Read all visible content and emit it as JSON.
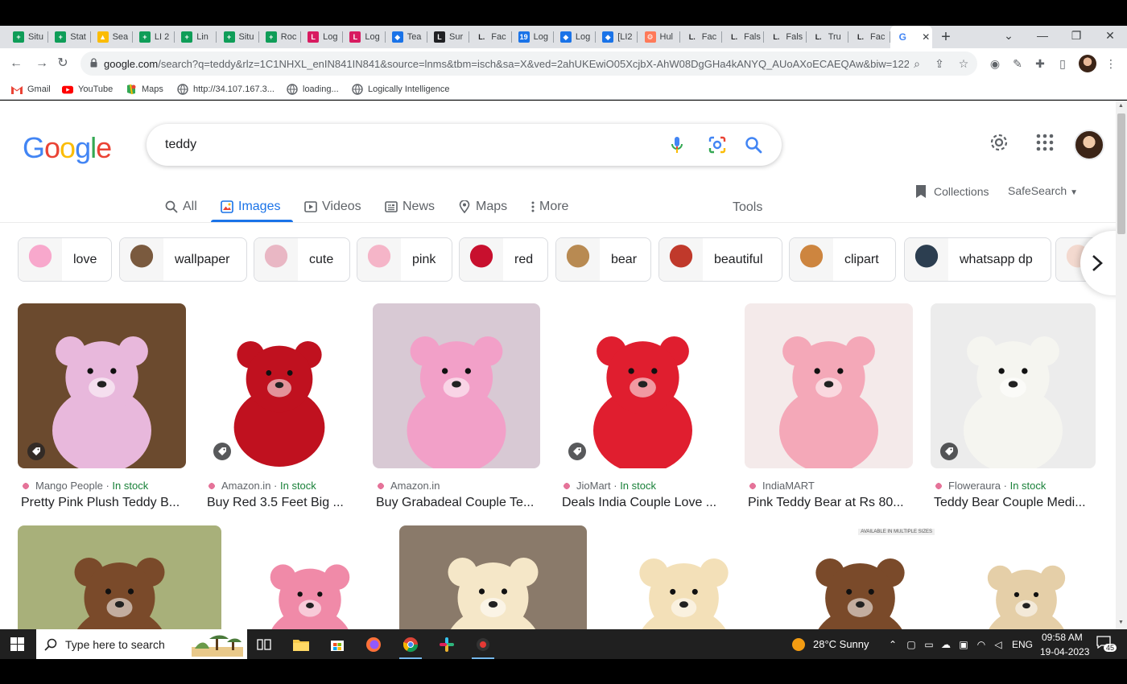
{
  "browser": {
    "tabs": [
      {
        "label": "Situ",
        "fav": "+",
        "color": "#0f9d58"
      },
      {
        "label": "Stat",
        "fav": "+",
        "color": "#0f9d58"
      },
      {
        "label": "Sea",
        "fav": "▲",
        "color": "#fbbc04"
      },
      {
        "label": "LI 2",
        "fav": "+",
        "color": "#0f9d58"
      },
      {
        "label": "Lin",
        "fav": "+",
        "color": "#0f9d58"
      },
      {
        "label": "Situ",
        "fav": "+",
        "color": "#0f9d58"
      },
      {
        "label": "Roc",
        "fav": "+",
        "color": "#0f9d58"
      },
      {
        "label": "Log",
        "fav": "L",
        "color": "#d81b60"
      },
      {
        "label": "Log",
        "fav": "L",
        "color": "#d81b60"
      },
      {
        "label": "Tea",
        "fav": "◆",
        "color": "#1a73e8"
      },
      {
        "label": "Sur",
        "fav": "L",
        "color": "#202124"
      },
      {
        "label": "Fac",
        "fav": "L.",
        "color": "#ffffff"
      },
      {
        "label": "Log",
        "fav": "19",
        "color": "#1a73e8"
      },
      {
        "label": "Log",
        "fav": "◆",
        "color": "#1a73e8"
      },
      {
        "label": "[LI2",
        "fav": "◆",
        "color": "#1a73e8"
      },
      {
        "label": "Hul",
        "fav": "⚙",
        "color": "#ff7a59"
      },
      {
        "label": "Fac",
        "fav": "L.",
        "color": "#ffffff"
      },
      {
        "label": "Fals",
        "fav": "L.",
        "color": "#ffffff"
      },
      {
        "label": "Fals",
        "fav": "L.",
        "color": "#ffffff"
      },
      {
        "label": "Tru",
        "fav": "L.",
        "color": "#ffffff"
      },
      {
        "label": "Fac",
        "fav": "L.",
        "color": "#ffffff"
      }
    ],
    "active_tab_close": "✕",
    "new_tab": "+",
    "url_host": "google.com",
    "url_rest": "/search?q=teddy&rlz=1C1NHXL_enIN841IN841&source=lnms&tbm=isch&sa=X&ved=2ahUKEwiO05XcjbX-AhW08DgGHa4kANYQ_AUoAXoECAEQAw&biw=1229...",
    "bookmarks": [
      {
        "label": "Gmail",
        "icon": "gmail-icon"
      },
      {
        "label": "YouTube",
        "icon": "youtube-icon"
      },
      {
        "label": "Maps",
        "icon": "maps-icon"
      },
      {
        "label": "http://34.107.167.3...",
        "icon": "globe-icon"
      },
      {
        "label": "loading...",
        "icon": "globe-icon"
      },
      {
        "label": "Logically Intelligence",
        "icon": "globe-icon"
      }
    ]
  },
  "search": {
    "query": "teddy",
    "tabs": [
      {
        "label": "All",
        "icon": "search-icon"
      },
      {
        "label": "Images",
        "icon": "image-icon"
      },
      {
        "label": "Videos",
        "icon": "video-icon"
      },
      {
        "label": "News",
        "icon": "news-icon"
      },
      {
        "label": "Maps",
        "icon": "map-pin-icon"
      },
      {
        "label": "More",
        "icon": "more-vert-icon"
      }
    ],
    "tools": "Tools",
    "collections": "Collections",
    "safesearch": "SafeSearch"
  },
  "chips": [
    {
      "label": "love",
      "color": "#f8a8cc"
    },
    {
      "label": "wallpaper",
      "color": "#7a5a3e"
    },
    {
      "label": "cute",
      "color": "#e9b7c4"
    },
    {
      "label": "pink",
      "color": "#f5b5c8"
    },
    {
      "label": "red",
      "color": "#c8102e"
    },
    {
      "label": "bear",
      "color": "#b88a52"
    },
    {
      "label": "beautiful",
      "color": "#c0392b"
    },
    {
      "label": "clipart",
      "color": "#cd853f"
    },
    {
      "label": "whatsapp dp",
      "color": "#2c3e50"
    },
    {
      "label": "",
      "color": "#f3d9cf"
    }
  ],
  "results": [
    {
      "source": "Mango People",
      "stock": "In stock",
      "title": "Pretty Pink Plush Teddy B...",
      "bg": "#6b4a2e",
      "bear": "#e8b8dc"
    },
    {
      "source": "Amazon.in",
      "stock": "In stock",
      "title": "Buy Red 3.5 Feet Big ...",
      "bg": "#ffffff",
      "bear": "#c0111f"
    },
    {
      "source": "Amazon.in",
      "stock": "",
      "title": "Buy Grabadeal Couple Te...",
      "bg": "#d8c9d4",
      "bear": "#f2a0c8"
    },
    {
      "source": "JioMart",
      "stock": "In stock",
      "title": "Deals India Couple Love ...",
      "bg": "#ffffff",
      "bear": "#e01e2f"
    },
    {
      "source": "IndiaMART",
      "stock": "",
      "title": "Pink Teddy Bear at Rs 80...",
      "bg": "#f4eaea",
      "bear": "#f4a8b8"
    },
    {
      "source": "Floweraura",
      "stock": "In stock",
      "title": "Teddy Bear Couple Medi...",
      "bg": "#ececec",
      "bear": "#f5f5f0"
    }
  ],
  "row2": [
    {
      "bg": "#a8b07a",
      "bear": "#7a4a2a"
    },
    {
      "bg": "#ffffff",
      "bear": "#f08aa8"
    },
    {
      "bg": "#8a7a6a",
      "bear": "#f5e7c8"
    },
    {
      "bg": "#ffffff",
      "bear": "#f3e0b8"
    },
    {
      "bg": "#ffffff",
      "bear": "#7a4a2a",
      "note": "AVAILABLE IN MULTIPLE SIZES"
    },
    {
      "bg": "#ffffff",
      "bear": "#e5cfa8"
    }
  ],
  "taskbar": {
    "search_placeholder": "Type here to search",
    "weather": "28°C  Sunny",
    "lang": "ENG",
    "time": "09:58 AM",
    "date": "19-04-2023",
    "notifications": "45"
  }
}
